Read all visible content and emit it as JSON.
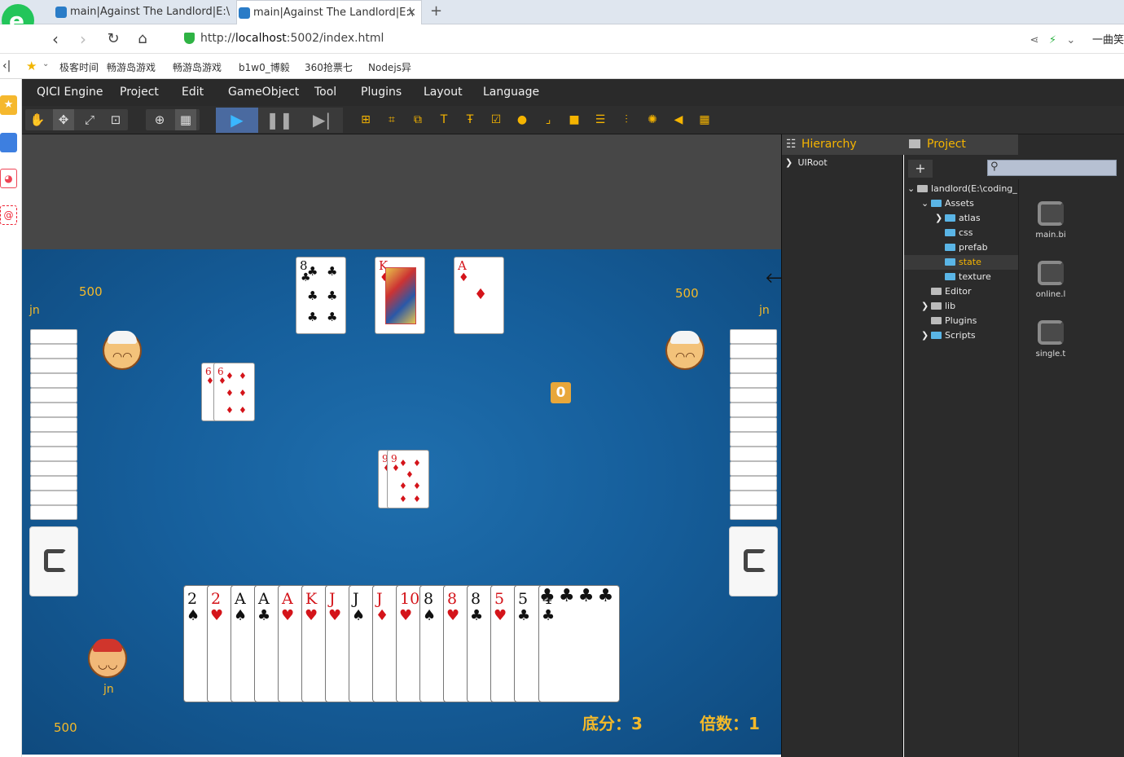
{
  "browser": {
    "tabs": [
      {
        "title": "main|Against The Landlord|E:\\",
        "active": false
      },
      {
        "title": "main|Against The Landlord|E:\\",
        "active": true
      }
    ],
    "url_prefix": "http://",
    "url_host": "localhost",
    "url_rest": ":5002/index.html",
    "right_text": "一曲笑",
    "bookmarks": [
      "极客时间",
      "畅游岛游戏",
      "畅游岛游戏",
      "b1w0_博毅",
      "360抢票七",
      "Nodejs异"
    ]
  },
  "editor": {
    "menu": [
      "QICI Engine",
      "Project",
      "Edit",
      "GameObject",
      "Tool",
      "Plugins",
      "Layout",
      "Language"
    ],
    "colors": {
      "accent": "#f5b400",
      "play_active": "#3ab7ff",
      "board": "#1a64a3"
    }
  },
  "game": {
    "left_score": "500",
    "left_name": "jn",
    "right_score": "500",
    "right_name": "jn",
    "bottom_score": "500",
    "bottom_name": "jn",
    "counter": "0",
    "base_score_label": "底分：3",
    "multiplier_label": "倍数：1",
    "top_cards": [
      {
        "rank": "8",
        "suit": "♣",
        "color": "black"
      },
      {
        "rank": "K",
        "suit": "♦",
        "color": "red"
      },
      {
        "rank": "A",
        "suit": "♦",
        "color": "red"
      }
    ],
    "left_played": [
      {
        "rank": "6",
        "suit": "♦",
        "color": "red"
      },
      {
        "rank": "6",
        "suit": "♦",
        "color": "red"
      }
    ],
    "center_played": [
      {
        "rank": "9",
        "suit": "♦",
        "color": "red"
      },
      {
        "rank": "9",
        "suit": "♦",
        "color": "red"
      }
    ],
    "hand": [
      {
        "rank": "2",
        "suit": "♠",
        "color": "black"
      },
      {
        "rank": "2",
        "suit": "♥",
        "color": "red"
      },
      {
        "rank": "A",
        "suit": "♠",
        "color": "black"
      },
      {
        "rank": "A",
        "suit": "♣",
        "color": "black"
      },
      {
        "rank": "A",
        "suit": "♥",
        "color": "red"
      },
      {
        "rank": "K",
        "suit": "♥",
        "color": "red"
      },
      {
        "rank": "J",
        "suit": "♥",
        "color": "red"
      },
      {
        "rank": "J",
        "suit": "♠",
        "color": "black"
      },
      {
        "rank": "J",
        "suit": "♦",
        "color": "red"
      },
      {
        "rank": "10",
        "suit": "♥",
        "color": "red"
      },
      {
        "rank": "8",
        "suit": "♠",
        "color": "black"
      },
      {
        "rank": "8",
        "suit": "♥",
        "color": "red"
      },
      {
        "rank": "8",
        "suit": "♣",
        "color": "black"
      },
      {
        "rank": "5",
        "suit": "♥",
        "color": "red"
      },
      {
        "rank": "5",
        "suit": "♣",
        "color": "black"
      },
      {
        "rank": "4",
        "suit": "♣",
        "color": "black"
      }
    ]
  },
  "hierarchy": {
    "title": "Hierarchy",
    "root": "UIRoot"
  },
  "project": {
    "title": "Project",
    "tree": [
      {
        "label": "landlord(E:\\coding_",
        "depth": 0,
        "arrow": "open",
        "icon": "gray",
        "selected": false
      },
      {
        "label": "Assets",
        "depth": 1,
        "arrow": "open",
        "icon": "blue",
        "selected": false
      },
      {
        "label": "atlas",
        "depth": 2,
        "arrow": "closed",
        "icon": "blue",
        "selected": false
      },
      {
        "label": "css",
        "depth": 2,
        "arrow": "",
        "icon": "blue",
        "selected": false
      },
      {
        "label": "prefab",
        "depth": 2,
        "arrow": "",
        "icon": "blue",
        "selected": false
      },
      {
        "label": "state",
        "depth": 2,
        "arrow": "",
        "icon": "blue",
        "selected": true
      },
      {
        "label": "texture",
        "depth": 2,
        "arrow": "",
        "icon": "blue",
        "selected": false
      },
      {
        "label": "Editor",
        "depth": 1,
        "arrow": "",
        "icon": "gray",
        "selected": false
      },
      {
        "label": "lib",
        "depth": 1,
        "arrow": "closed",
        "icon": "gray",
        "selected": false
      },
      {
        "label": "Plugins",
        "depth": 1,
        "arrow": "",
        "icon": "gray",
        "selected": false
      },
      {
        "label": "Scripts",
        "depth": 1,
        "arrow": "closed",
        "icon": "blue",
        "selected": false
      }
    ],
    "assets": [
      "main.bi",
      "online.l",
      "single.t"
    ]
  }
}
